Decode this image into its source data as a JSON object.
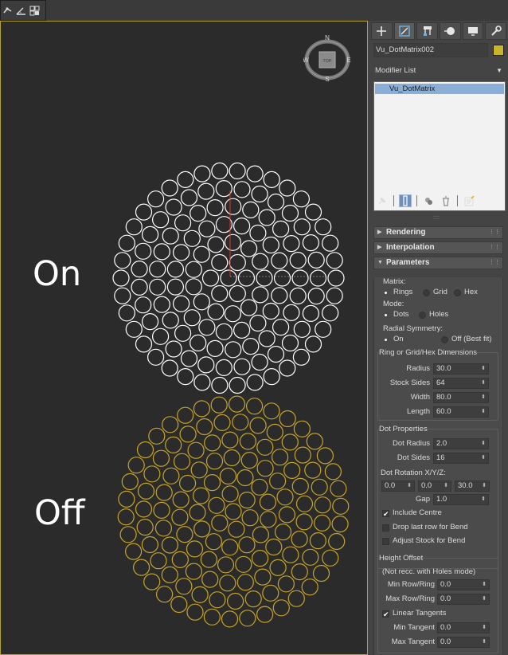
{
  "icons": {
    "top_toolbar": [
      "snap-toggle-icon",
      "angle-snap-icon",
      "percent-snap-icon"
    ],
    "tabs": [
      "create-icon",
      "modify-icon",
      "hierarchy-icon",
      "motion-icon",
      "display-icon",
      "utilities-icon"
    ],
    "stack_tools": [
      "pin-stack-icon",
      "show-end-result-icon",
      "make-unique-icon",
      "remove-modifier-icon",
      "configure-modifier-sets-icon"
    ]
  },
  "viewcube": {
    "north": "N",
    "south": "S",
    "east": "E",
    "west": "W",
    "face": "TOP"
  },
  "viewport": {
    "label_on": "On",
    "label_off": "Off",
    "colors": {
      "background": "#2b2b2b",
      "border": "#b4a12c",
      "on_dots": "#ffffff",
      "off_dots": "#c7a526",
      "gizmo": "#d03a3a"
    }
  },
  "panel": {
    "object_name": "Vu_DotMatrix002",
    "object_color": "#c9b42c",
    "modifier_list": "Modifier List",
    "stack_items": [
      "Vu_DotMatrix"
    ],
    "rollouts": {
      "rendering": "Rendering",
      "interpolation": "Interpolation",
      "parameters": "Parameters"
    },
    "params": {
      "matrix_label": "Matrix:",
      "matrix_options": [
        "Rings",
        "Grid",
        "Hex"
      ],
      "matrix_selected": "Rings",
      "mode_label": "Mode:",
      "mode_options": [
        "Dots",
        "Holes"
      ],
      "mode_selected": "Dots",
      "radial_label": "Radial Symmetry:",
      "radial_options": [
        "On",
        "Off (Best fit)"
      ],
      "radial_selected": "On",
      "dimensions": {
        "title": "Ring or Grid/Hex Dimensions",
        "radius_label": "Radius",
        "radius": "30.0",
        "stock_sides_label": "Stock Sides",
        "stock_sides": "64",
        "width_label": "Width",
        "width": "80.0",
        "length_label": "Length",
        "length": "60.0"
      },
      "dot": {
        "title": "Dot Properties",
        "dot_radius_label": "Dot Radius",
        "dot_radius": "2.0",
        "dot_sides_label": "Dot Sides",
        "dot_sides": "16",
        "rotation_label": "Dot Rotation X/Y/Z:",
        "rot_x": "0.0",
        "rot_y": "0.0",
        "rot_z": "30.0",
        "gap_label": "Gap",
        "gap": "1.0",
        "include_centre": "Include Centre",
        "include_centre_checked": true,
        "drop_last_row": "Drop last row for Bend",
        "drop_last_row_checked": false,
        "adjust_stock": "Adjust Stock for Bend",
        "adjust_stock_checked": false
      },
      "height": {
        "title": "Height Offset",
        "note": "(Not recc. with Holes mode)",
        "min_row_label": "Min Row/Ring",
        "min_row": "0.0",
        "max_row_label": "Max Row/Ring",
        "max_row": "0.0",
        "linear_tangents": "Linear Tangents",
        "linear_tangents_checked": true,
        "min_tangent_label": "Min Tangent",
        "min_tangent": "0.0",
        "max_tangent_label": "Max Tangent",
        "max_tangent": "0.0"
      }
    }
  }
}
